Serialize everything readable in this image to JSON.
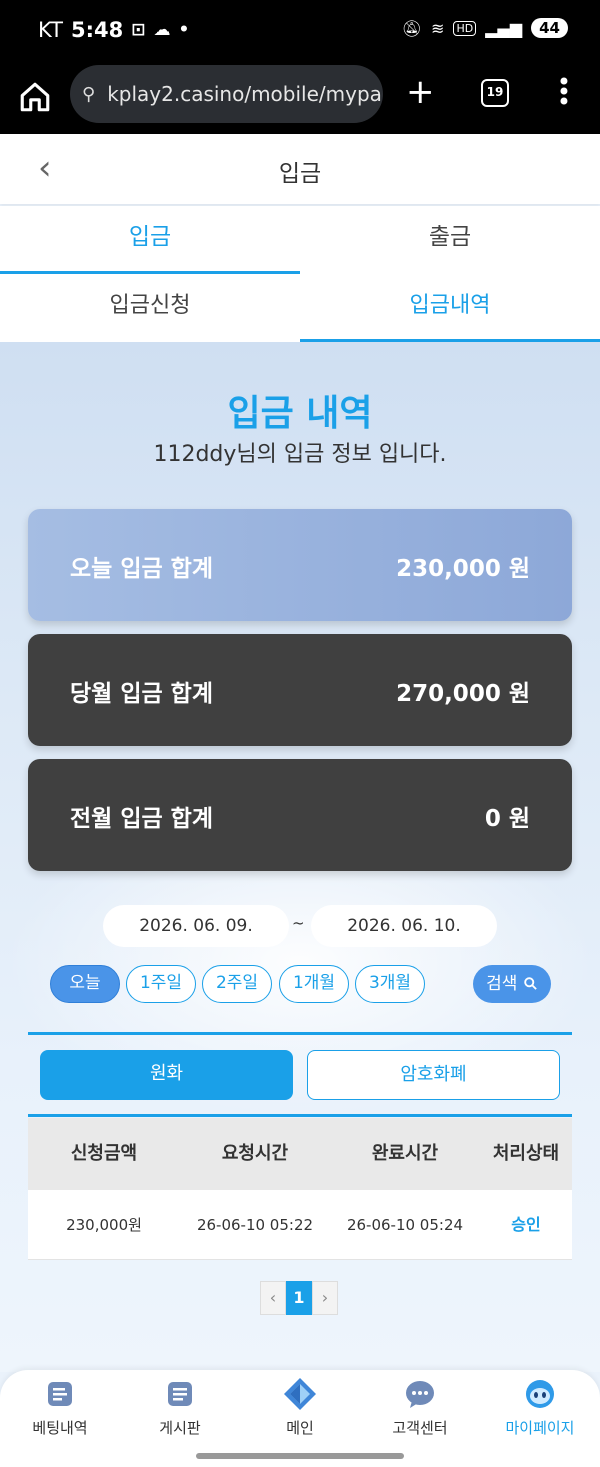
{
  "status_bar": {
    "carrier": "KT",
    "time": "5:48",
    "battery": "44",
    "hd_label": "HD"
  },
  "browser": {
    "url": "kplay2.casino/mobile/mypa",
    "tab_count": "19"
  },
  "header": {
    "title": "입금"
  },
  "main_tabs": [
    {
      "label": "입금",
      "active": true
    },
    {
      "label": "출금",
      "active": false
    }
  ],
  "sub_tabs": [
    {
      "label": "입금신청",
      "active": false
    },
    {
      "label": "입금내역",
      "active": true
    }
  ],
  "section": {
    "title": "입금 내역",
    "subtitle": "112ddy님의 입금 정보 입니다."
  },
  "summary": {
    "today": {
      "label": "오늘 입금 합계",
      "amount": "230,000 원"
    },
    "month": {
      "label": "당월 입금 합계",
      "amount": "270,000 원"
    },
    "prev_month": {
      "label": "전월 입금 합계",
      "amount": "0 원"
    }
  },
  "date_range": {
    "start": "2026. 06. 09.",
    "separator": "~",
    "end": "2026. 06. 10."
  },
  "period_buttons": [
    {
      "label": "오늘",
      "active": true
    },
    {
      "label": "1주일",
      "active": false
    },
    {
      "label": "2주일",
      "active": false
    },
    {
      "label": "1개월",
      "active": false
    },
    {
      "label": "3개월",
      "active": false
    }
  ],
  "search_label": "검색",
  "currency_tabs": [
    {
      "label": "원화",
      "active": true
    },
    {
      "label": "암호화폐",
      "active": false
    }
  ],
  "table": {
    "headers": [
      "신청금액",
      "요청시간",
      "완료시간",
      "처리상태"
    ],
    "rows": [
      [
        "230,000원",
        "26-06-10 05:22",
        "26-06-10 05:24",
        "승인"
      ]
    ]
  },
  "pagination": {
    "prev": "‹",
    "current": "1",
    "next": "›"
  },
  "bottom_nav": [
    {
      "label": "베팅내역",
      "icon": "betting-history-icon"
    },
    {
      "label": "게시판",
      "icon": "board-icon"
    },
    {
      "label": "메인",
      "icon": "main-diamond-icon"
    },
    {
      "label": "고객센터",
      "icon": "chat-bubble-icon"
    },
    {
      "label": "마이페이지",
      "icon": "mascot-face-icon",
      "active": true
    }
  ],
  "colors": {
    "accent": "#1aa0e8",
    "dark_card": "#404040",
    "today_card": "#9bb4df"
  }
}
